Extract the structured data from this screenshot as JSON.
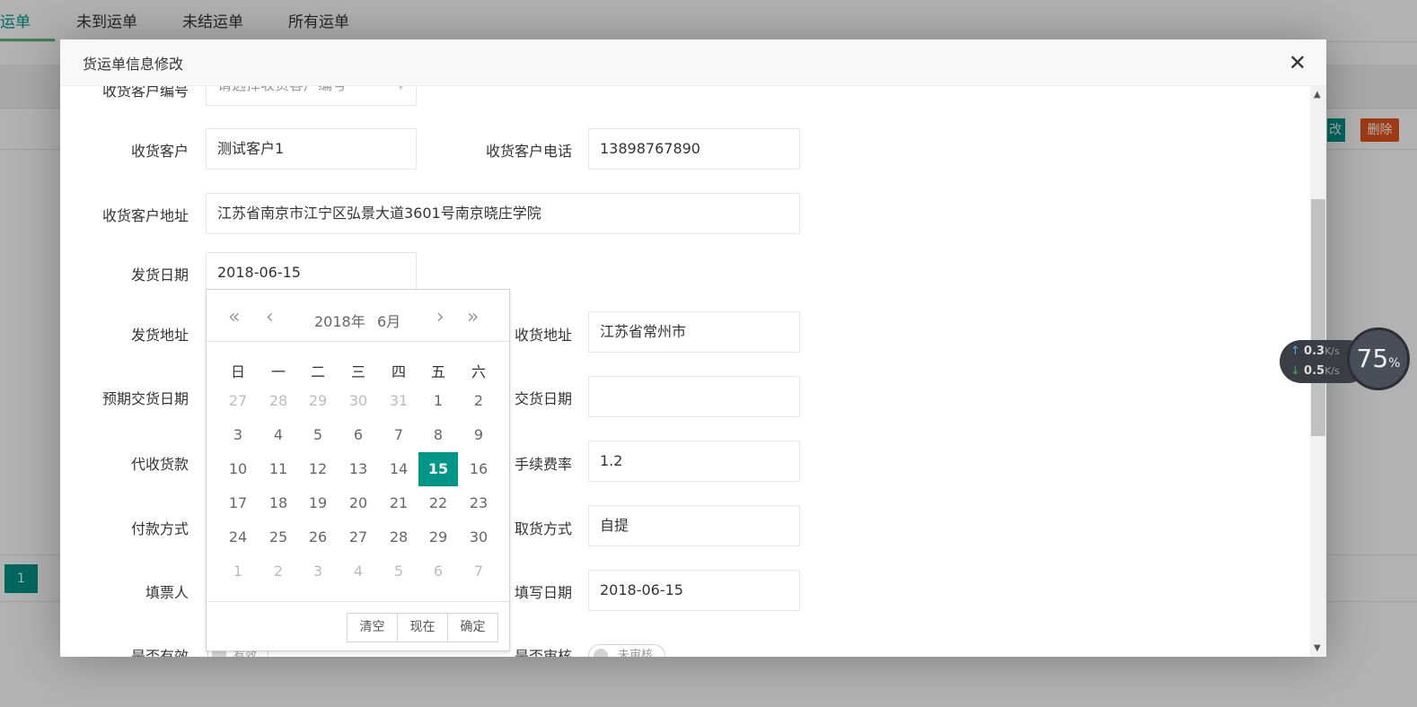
{
  "background": {
    "tabs": [
      {
        "label": "运单",
        "active": true
      },
      {
        "label": "未到运单"
      },
      {
        "label": "未结运单"
      },
      {
        "label": "所有运单"
      }
    ],
    "row_buttons": {
      "edit": "改",
      "delete": "删除"
    },
    "pagination": {
      "current": "1"
    },
    "accent": "#009688",
    "danger": "#e2541c"
  },
  "modal": {
    "title": "货运单信息修改",
    "fields": {
      "receiver_code": {
        "label": "收货客户编号",
        "placeholder": "请选择收货客户编号"
      },
      "receiver": {
        "label": "收货客户",
        "value": "测试客户1"
      },
      "receiver_phone": {
        "label": "收货客户电话",
        "value": "13898767890"
      },
      "receiver_address": {
        "label": "收货客户地址",
        "value": "江苏省南京市江宁区弘景大道3601号南京晓庄学院"
      },
      "ship_date": {
        "label": "发货日期",
        "value": "2018-06-15"
      },
      "ship_address": {
        "label": "发货地址"
      },
      "receive_address": {
        "label": "收货地址",
        "value": "江苏省常州市"
      },
      "expected_date": {
        "label": "预期交货日期"
      },
      "delivery_date": {
        "label": "交货日期",
        "value": ""
      },
      "cod": {
        "label": "代收货款"
      },
      "fee_rate": {
        "label": "手续费率",
        "value": "1.2"
      },
      "payment": {
        "label": "付款方式"
      },
      "pickup": {
        "label": "取货方式",
        "value": "自提"
      },
      "filler": {
        "label": "填票人"
      },
      "fill_date": {
        "label": "填写日期",
        "value": "2018-06-15"
      },
      "valid": {
        "label": "是否有效",
        "toggle": "有效"
      },
      "audited": {
        "label": "是否审核",
        "toggle": "未审核"
      }
    }
  },
  "calendar": {
    "year": "2018年",
    "month": "6月",
    "weekdays": [
      "日",
      "一",
      "二",
      "三",
      "四",
      "五",
      "六"
    ],
    "days": [
      [
        "27",
        "28",
        "29",
        "30",
        "31",
        "1",
        "2"
      ],
      [
        "3",
        "4",
        "5",
        "6",
        "7",
        "8",
        "9"
      ],
      [
        "10",
        "11",
        "12",
        "13",
        "14",
        "15",
        "16"
      ],
      [
        "17",
        "18",
        "19",
        "20",
        "21",
        "22",
        "23"
      ],
      [
        "24",
        "25",
        "26",
        "27",
        "28",
        "29",
        "30"
      ],
      [
        "1",
        "2",
        "3",
        "4",
        "5",
        "6",
        "7"
      ]
    ],
    "selected": "15",
    "buttons": {
      "clear": "清空",
      "now": "现在",
      "confirm": "确定"
    }
  },
  "net_widget": {
    "up": "0.3",
    "down": "0.5",
    "unit": "K/s",
    "percent": "75",
    "percent_sign": "%"
  }
}
